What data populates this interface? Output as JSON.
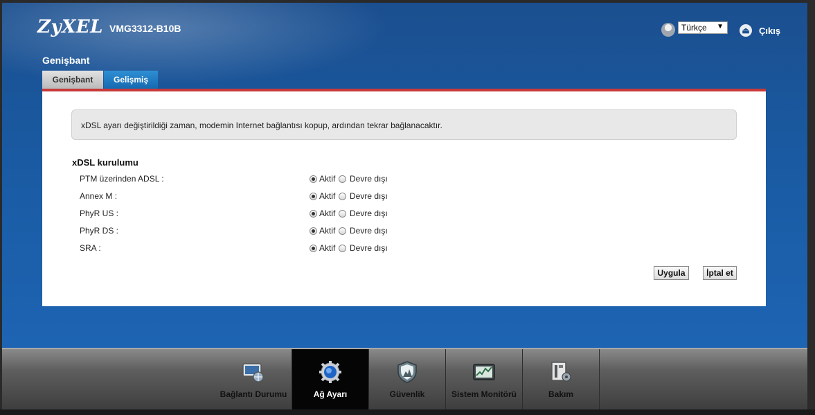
{
  "header": {
    "brand": "ZyXEL",
    "model": "VMG3312-B10B",
    "language": "Türkçe",
    "logout_label": "Çıkış"
  },
  "page": {
    "section_title": "Genişbant",
    "tabs": [
      {
        "label": "Genişbant",
        "active": false
      },
      {
        "label": "Gelişmiş",
        "active": true
      }
    ]
  },
  "notice": {
    "text": "xDSL ayarı değiştirildiği zaman, modemin Internet bağlantısı kopup, ardından tekrar bağlanacaktır."
  },
  "setup": {
    "title": "xDSL kurulumu",
    "option_on": "Aktif",
    "option_off": "Devre dışı",
    "rows": [
      {
        "label": "PTM üzerinden ADSL :",
        "value": "Aktif"
      },
      {
        "label": "Annex M :",
        "value": "Aktif"
      },
      {
        "label": "PhyR US :",
        "value": "Aktif"
      },
      {
        "label": "PhyR DS :",
        "value": "Aktif"
      },
      {
        "label": "SRA :",
        "value": "Aktif"
      }
    ]
  },
  "buttons": {
    "apply": "Uygula",
    "cancel": "İptal et"
  },
  "bottom_nav": [
    {
      "label": "Bağlantı Durumu",
      "icon": "connection-status-icon",
      "active": false
    },
    {
      "label": "Ağ Ayarı",
      "icon": "network-settings-gear-icon",
      "active": true
    },
    {
      "label": "Güvenlik",
      "icon": "security-shield-icon",
      "active": false
    },
    {
      "label": "Sistem Monitörü",
      "icon": "system-monitor-icon",
      "active": false
    },
    {
      "label": "Bakım",
      "icon": "maintenance-icon",
      "active": false
    }
  ],
  "colors": {
    "header_blue": "#1b4f8f",
    "active_tab": "#1f7bc4",
    "accent_red": "#c8393a"
  }
}
